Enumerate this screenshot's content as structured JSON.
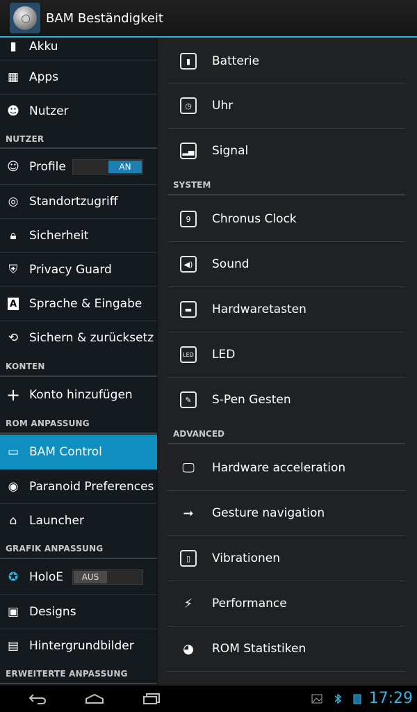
{
  "app": {
    "title": "BAM Beständigkeit"
  },
  "left": {
    "items_top": [
      {
        "label": "Akku",
        "icon": "battery-icon"
      },
      {
        "label": "Apps",
        "icon": "apps-icon"
      },
      {
        "label": "Nutzer",
        "icon": "user-icon"
      }
    ],
    "section_nutzer": "NUTZER",
    "profile_label": "Profile",
    "profile_toggle": "AN",
    "nutzer_items": [
      {
        "label": "Standortzugriff",
        "icon": "location-icon"
      },
      {
        "label": "Sicherheit",
        "icon": "lock-icon"
      },
      {
        "label": "Privacy Guard",
        "icon": "shield-icon"
      },
      {
        "label": "Sprache & Eingabe",
        "icon": "language-icon"
      },
      {
        "label": "Sichern & zurücksetz",
        "icon": "backup-icon"
      }
    ],
    "section_konten": "KONTEN",
    "konto_add": "Konto hinzufügen",
    "section_rom": "ROM ANPASSUNG",
    "rom_items": [
      {
        "label": "BAM Control",
        "icon": "bam-control-icon",
        "selected": true
      },
      {
        "label": "Paranoid Preferences",
        "icon": "paranoid-icon"
      },
      {
        "label": "Launcher",
        "icon": "home-icon"
      }
    ],
    "section_grafik": "GRAFIK ANPASSUNG",
    "holo_label": "HoloE",
    "holo_toggle": "AUS",
    "grafik_items": [
      {
        "label": "Designs",
        "icon": "designs-icon"
      },
      {
        "label": "Hintergrundbilder",
        "icon": "wallpaper-icon"
      }
    ],
    "section_erweiterte": "ERWEITERTE ANPASSUNG"
  },
  "right": {
    "items_a": [
      {
        "label": "Batterie",
        "icon": "battery-icon"
      },
      {
        "label": "Uhr",
        "icon": "clock-icon"
      },
      {
        "label": "Signal",
        "icon": "signal-icon"
      }
    ],
    "section_system": "SYSTEM",
    "items_system": [
      {
        "label": "Chronus Clock",
        "icon": "chronus-icon"
      },
      {
        "label": "Sound",
        "icon": "sound-icon"
      },
      {
        "label": "Hardwaretasten",
        "icon": "keyboard-icon"
      },
      {
        "label": "LED",
        "icon": "led-icon"
      },
      {
        "label": "S-Pen Gesten",
        "icon": "spen-icon"
      }
    ],
    "section_advanced": "ADVANCED",
    "items_advanced": [
      {
        "label": "Hardware acceleration",
        "icon": "monitor-icon"
      },
      {
        "label": "Gesture navigation",
        "icon": "arrow-right-icon"
      },
      {
        "label": "Vibrationen",
        "icon": "vibration-icon"
      },
      {
        "label": "Performance",
        "icon": "lightning-icon"
      },
      {
        "label": "ROM Statistiken",
        "icon": "statistics-icon"
      }
    ]
  },
  "status": {
    "time": "17:29"
  },
  "colors": {
    "accent": "#33b5e5",
    "selected": "#0f8fbf"
  }
}
